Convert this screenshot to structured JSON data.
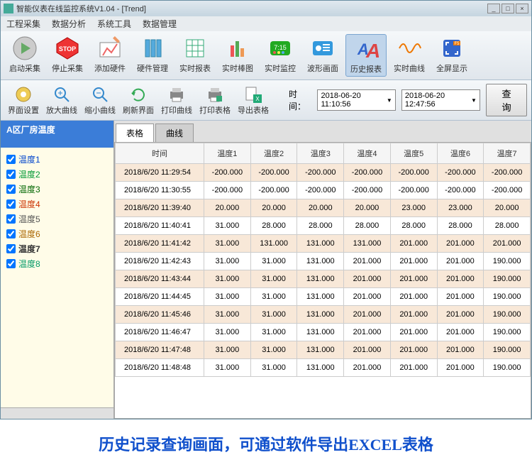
{
  "window": {
    "title": "智能仪表在线监控系统V1.04 - [Trend]"
  },
  "menu": [
    "工程采集",
    "数据分析",
    "系统工具",
    "数据管理"
  ],
  "toolbar1": [
    {
      "label": "启动采集",
      "name": "start-collect"
    },
    {
      "label": "停止采集",
      "name": "stop-collect"
    },
    {
      "label": "添加硬件",
      "name": "add-hardware"
    },
    {
      "label": "硬件管理",
      "name": "hardware-mgmt"
    },
    {
      "label": "实时报表",
      "name": "realtime-report"
    },
    {
      "label": "实时棒图",
      "name": "realtime-bar"
    },
    {
      "label": "实时监控",
      "name": "realtime-monitor"
    },
    {
      "label": "波形画面",
      "name": "waveform"
    },
    {
      "label": "历史报表",
      "name": "history-report"
    },
    {
      "label": "实时曲线",
      "name": "realtime-curve"
    },
    {
      "label": "全屏显示",
      "name": "fullscreen"
    }
  ],
  "toolbar2": [
    {
      "label": "界面设置",
      "name": "ui-settings"
    },
    {
      "label": "放大曲线",
      "name": "zoom-in"
    },
    {
      "label": "缩小曲线",
      "name": "zoom-out"
    },
    {
      "label": "刷新界面",
      "name": "refresh"
    },
    {
      "label": "打印曲线",
      "name": "print-curve"
    },
    {
      "label": "打印表格",
      "name": "print-table"
    },
    {
      "label": "导出表格",
      "name": "export-table"
    }
  ],
  "time": {
    "label": "时间：",
    "from": "2018-06-20 11:10:56",
    "to": "2018-06-20 12:47:56",
    "query": "查询"
  },
  "side": {
    "head": "A区厂房温度",
    "items": [
      "温度1",
      "温度2",
      "温度3",
      "温度4",
      "温度5",
      "温度6",
      "温度7",
      "温度8"
    ]
  },
  "tabs": [
    "表格",
    "曲线"
  ],
  "table": {
    "headers": [
      "时间",
      "温度1",
      "温度2",
      "温度3",
      "温度4",
      "温度5",
      "温度6",
      "温度7"
    ],
    "rows": [
      [
        "2018/6/20 11:29:54",
        "-200.000",
        "-200.000",
        "-200.000",
        "-200.000",
        "-200.000",
        "-200.000",
        "-200.000"
      ],
      [
        "2018/6/20 11:30:55",
        "-200.000",
        "-200.000",
        "-200.000",
        "-200.000",
        "-200.000",
        "-200.000",
        "-200.000"
      ],
      [
        "2018/6/20 11:39:40",
        "20.000",
        "20.000",
        "20.000",
        "20.000",
        "23.000",
        "23.000",
        "20.000"
      ],
      [
        "2018/6/20 11:40:41",
        "31.000",
        "28.000",
        "28.000",
        "28.000",
        "28.000",
        "28.000",
        "28.000"
      ],
      [
        "2018/6/20 11:41:42",
        "31.000",
        "131.000",
        "131.000",
        "131.000",
        "201.000",
        "201.000",
        "201.000"
      ],
      [
        "2018/6/20 11:42:43",
        "31.000",
        "31.000",
        "131.000",
        "201.000",
        "201.000",
        "201.000",
        "190.000"
      ],
      [
        "2018/6/20 11:43:44",
        "31.000",
        "31.000",
        "131.000",
        "201.000",
        "201.000",
        "201.000",
        "190.000"
      ],
      [
        "2018/6/20 11:44:45",
        "31.000",
        "31.000",
        "131.000",
        "201.000",
        "201.000",
        "201.000",
        "190.000"
      ],
      [
        "2018/6/20 11:45:46",
        "31.000",
        "31.000",
        "131.000",
        "201.000",
        "201.000",
        "201.000",
        "190.000"
      ],
      [
        "2018/6/20 11:46:47",
        "31.000",
        "31.000",
        "131.000",
        "201.000",
        "201.000",
        "201.000",
        "190.000"
      ],
      [
        "2018/6/20 11:47:48",
        "31.000",
        "31.000",
        "131.000",
        "201.000",
        "201.000",
        "201.000",
        "190.000"
      ],
      [
        "2018/6/20 11:48:48",
        "31.000",
        "31.000",
        "131.000",
        "201.000",
        "201.000",
        "201.000",
        "190.000"
      ]
    ]
  },
  "caption": "历史记录查询画面，可通过软件导出EXCEL表格"
}
